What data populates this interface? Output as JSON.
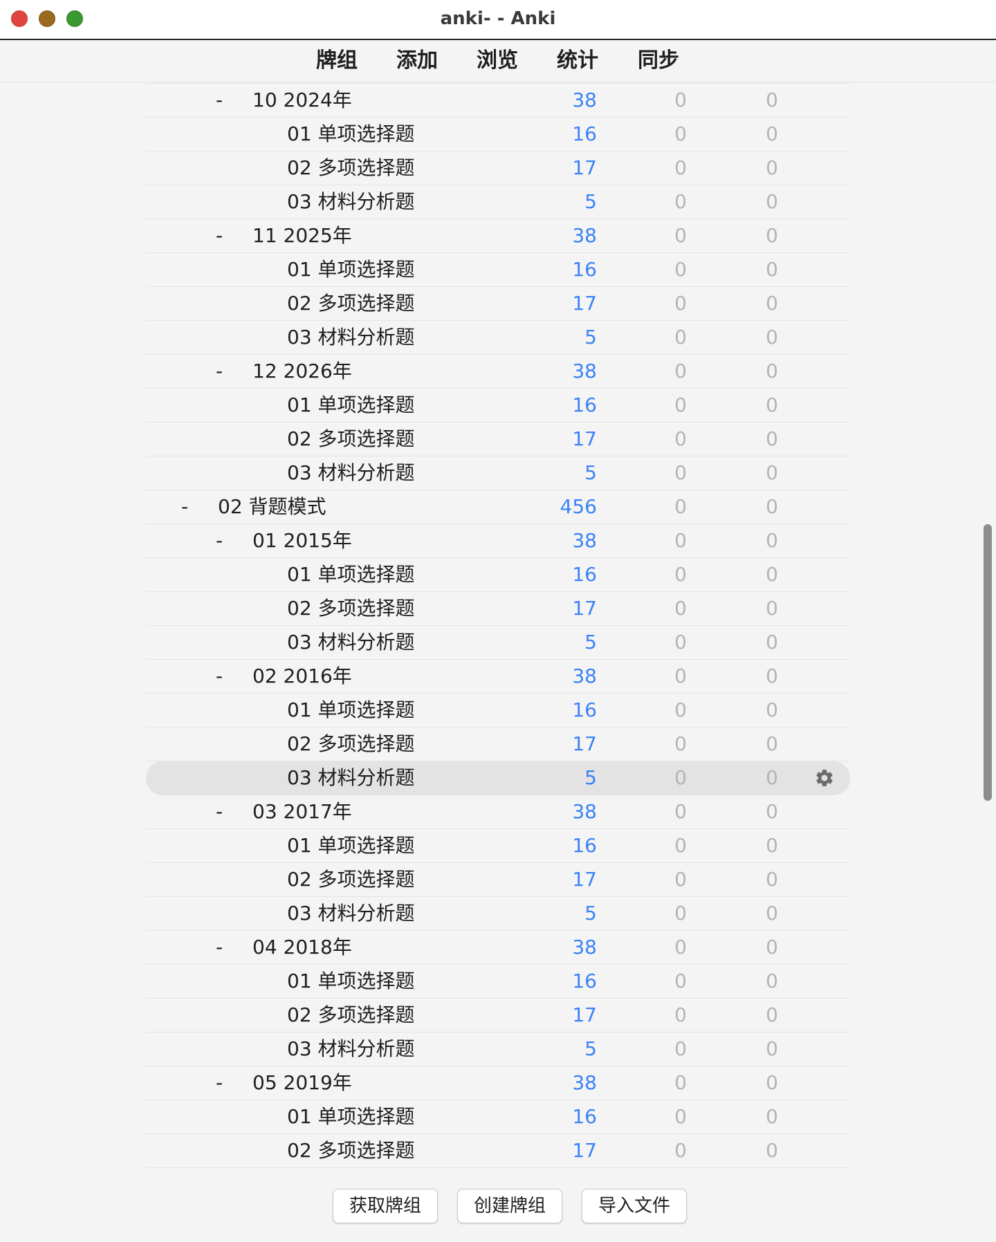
{
  "window": {
    "title": "anki- - Anki",
    "controls": {
      "close_color": "#e0443e",
      "minimize_color": "#9a6a1f",
      "zoom_color": "#3a9a32"
    }
  },
  "toolbar": {
    "items": [
      "牌组",
      "添加",
      "浏览",
      "统计",
      "同步"
    ]
  },
  "colors": {
    "new_count": "#3b82f6",
    "zero_count": "#b4b4b4",
    "selected_row": "#e3e3e3"
  },
  "decks": [
    {
      "level": 2,
      "collapse": "-",
      "name": "10 2024年",
      "new": "38",
      "learn": "0",
      "due": "0"
    },
    {
      "level": 3,
      "collapse": "",
      "name": "01 单项选择题",
      "new": "16",
      "learn": "0",
      "due": "0"
    },
    {
      "level": 3,
      "collapse": "",
      "name": "02 多项选择题",
      "new": "17",
      "learn": "0",
      "due": "0"
    },
    {
      "level": 3,
      "collapse": "",
      "name": "03 材料分析题",
      "new": "5",
      "learn": "0",
      "due": "0"
    },
    {
      "level": 2,
      "collapse": "-",
      "name": "11 2025年",
      "new": "38",
      "learn": "0",
      "due": "0"
    },
    {
      "level": 3,
      "collapse": "",
      "name": "01 单项选择题",
      "new": "16",
      "learn": "0",
      "due": "0"
    },
    {
      "level": 3,
      "collapse": "",
      "name": "02 多项选择题",
      "new": "17",
      "learn": "0",
      "due": "0"
    },
    {
      "level": 3,
      "collapse": "",
      "name": "03 材料分析题",
      "new": "5",
      "learn": "0",
      "due": "0"
    },
    {
      "level": 2,
      "collapse": "-",
      "name": "12 2026年",
      "new": "38",
      "learn": "0",
      "due": "0"
    },
    {
      "level": 3,
      "collapse": "",
      "name": "01 单项选择题",
      "new": "16",
      "learn": "0",
      "due": "0"
    },
    {
      "level": 3,
      "collapse": "",
      "name": "02 多项选择题",
      "new": "17",
      "learn": "0",
      "due": "0"
    },
    {
      "level": 3,
      "collapse": "",
      "name": "03 材料分析题",
      "new": "5",
      "learn": "0",
      "due": "0"
    },
    {
      "level": 1,
      "collapse": "-",
      "name": "02 背题模式",
      "new": "456",
      "learn": "0",
      "due": "0"
    },
    {
      "level": 2,
      "collapse": "-",
      "name": "01 2015年",
      "new": "38",
      "learn": "0",
      "due": "0"
    },
    {
      "level": 3,
      "collapse": "",
      "name": "01 单项选择题",
      "new": "16",
      "learn": "0",
      "due": "0"
    },
    {
      "level": 3,
      "collapse": "",
      "name": "02 多项选择题",
      "new": "17",
      "learn": "0",
      "due": "0"
    },
    {
      "level": 3,
      "collapse": "",
      "name": "03 材料分析题",
      "new": "5",
      "learn": "0",
      "due": "0"
    },
    {
      "level": 2,
      "collapse": "-",
      "name": "02 2016年",
      "new": "38",
      "learn": "0",
      "due": "0"
    },
    {
      "level": 3,
      "collapse": "",
      "name": "01 单项选择题",
      "new": "16",
      "learn": "0",
      "due": "0"
    },
    {
      "level": 3,
      "collapse": "",
      "name": "02 多项选择题",
      "new": "17",
      "learn": "0",
      "due": "0"
    },
    {
      "level": 3,
      "collapse": "",
      "name": "03 材料分析题",
      "new": "5",
      "learn": "0",
      "due": "0",
      "selected": true
    },
    {
      "level": 2,
      "collapse": "-",
      "name": "03 2017年",
      "new": "38",
      "learn": "0",
      "due": "0"
    },
    {
      "level": 3,
      "collapse": "",
      "name": "01 单项选择题",
      "new": "16",
      "learn": "0",
      "due": "0"
    },
    {
      "level": 3,
      "collapse": "",
      "name": "02 多项选择题",
      "new": "17",
      "learn": "0",
      "due": "0"
    },
    {
      "level": 3,
      "collapse": "",
      "name": "03 材料分析题",
      "new": "5",
      "learn": "0",
      "due": "0"
    },
    {
      "level": 2,
      "collapse": "-",
      "name": "04 2018年",
      "new": "38",
      "learn": "0",
      "due": "0"
    },
    {
      "level": 3,
      "collapse": "",
      "name": "01 单项选择题",
      "new": "16",
      "learn": "0",
      "due": "0"
    },
    {
      "level": 3,
      "collapse": "",
      "name": "02 多项选择题",
      "new": "17",
      "learn": "0",
      "due": "0"
    },
    {
      "level": 3,
      "collapse": "",
      "name": "03 材料分析题",
      "new": "5",
      "learn": "0",
      "due": "0"
    },
    {
      "level": 2,
      "collapse": "-",
      "name": "05 2019年",
      "new": "38",
      "learn": "0",
      "due": "0"
    },
    {
      "level": 3,
      "collapse": "",
      "name": "01 单项选择题",
      "new": "16",
      "learn": "0",
      "due": "0"
    },
    {
      "level": 3,
      "collapse": "",
      "name": "02 多项选择题",
      "new": "17",
      "learn": "0",
      "due": "0"
    }
  ],
  "gear_icon": "gear-icon",
  "bottom_buttons": {
    "get_shared": "获取牌组",
    "create_deck": "创建牌组",
    "import_file": "导入文件"
  }
}
